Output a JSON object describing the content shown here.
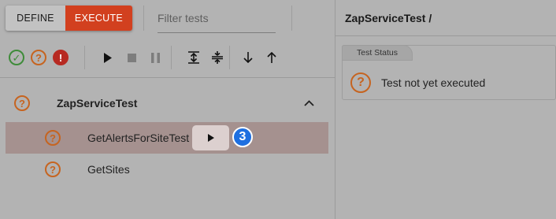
{
  "toolbar": {
    "define_label": "DEFINE",
    "execute_label": "EXECUTE",
    "filter_placeholder": "Filter tests",
    "filter_value": ""
  },
  "status_filters": [
    {
      "name": "passed-filter-icon",
      "glyph": "✓"
    },
    {
      "name": "unknown-filter-icon",
      "glyph": "?"
    },
    {
      "name": "failed-filter-icon",
      "glyph": "!"
    }
  ],
  "tree": {
    "suite": {
      "name": "ZapServiceTest",
      "status_glyph": "?"
    },
    "tests": [
      {
        "name": "GetAlertsForSiteTest",
        "status_glyph": "?",
        "selected": true
      },
      {
        "name": "GetSites",
        "status_glyph": "?",
        "selected": false
      }
    ],
    "badge_count": "3"
  },
  "details": {
    "breadcrumb": "ZapServiceTest /",
    "card_title": "Test Status",
    "status_glyph": "?",
    "status_text": "Test not yet executed"
  },
  "colors": {
    "accent": "#d2401f",
    "pass": "#3f8c3a",
    "unknown": "#c66420",
    "fail": "#b72a22",
    "badge": "#1e6fe0",
    "selected_row": "#a5918f"
  }
}
